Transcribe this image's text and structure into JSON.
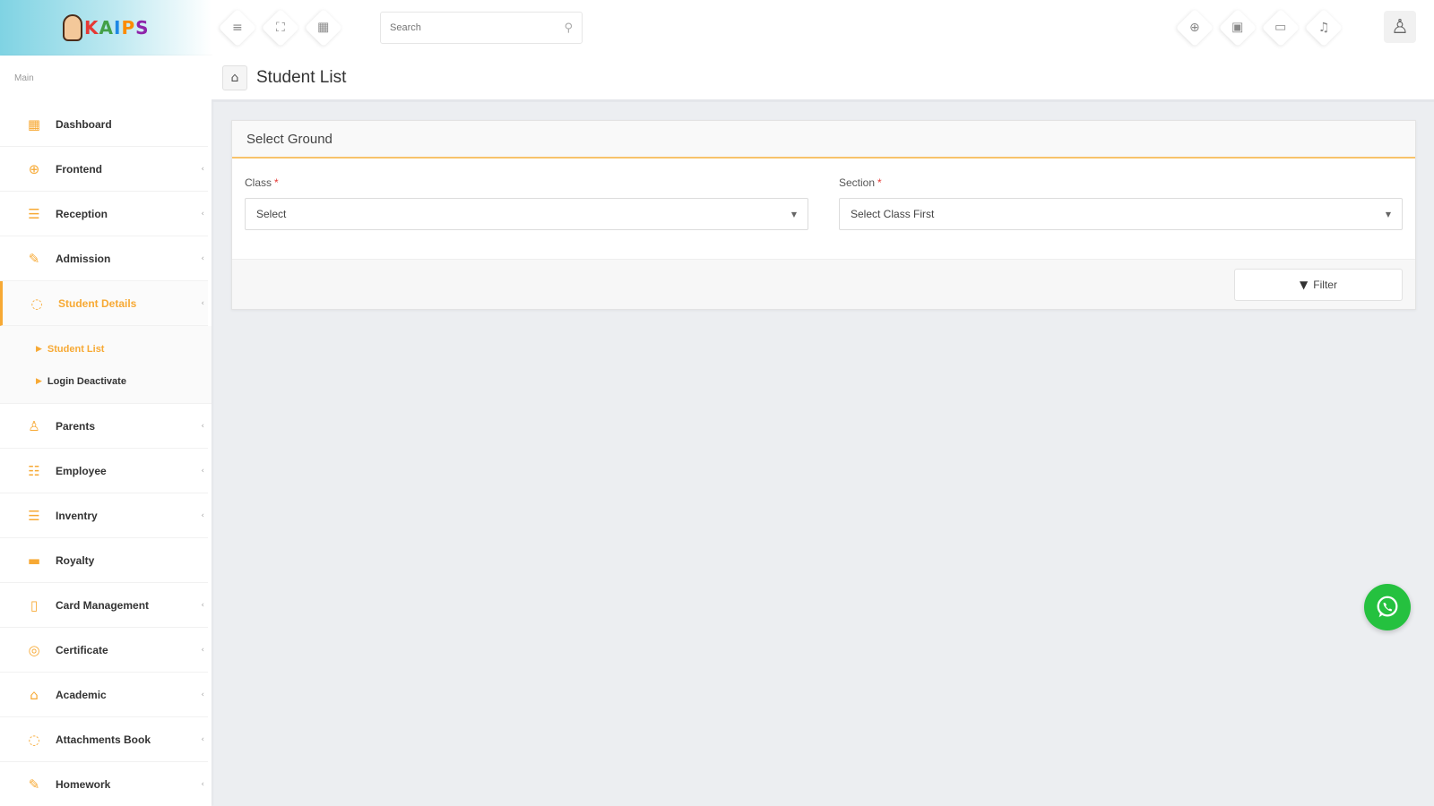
{
  "brand": {
    "logo_letters": [
      "K",
      "A",
      "I",
      "P",
      "S"
    ]
  },
  "header": {
    "search_placeholder": "Search",
    "left_tools": [
      {
        "icon": "menu-icon",
        "glyph": "≡"
      },
      {
        "icon": "fullscreen-icon",
        "glyph": "⛶"
      },
      {
        "icon": "grid-icon",
        "glyph": "▦"
      }
    ],
    "right_tools": [
      {
        "icon": "globe-icon",
        "glyph": "⊕"
      },
      {
        "icon": "calendar-icon",
        "glyph": "▣"
      },
      {
        "icon": "chat-icon",
        "glyph": "▭"
      },
      {
        "icon": "bell-icon",
        "glyph": "♫"
      }
    ]
  },
  "sidebar": {
    "heading": "Main",
    "items": [
      {
        "label": "Dashboard",
        "icon": "▦",
        "has_arrow": false
      },
      {
        "label": "Frontend",
        "icon": "⊕",
        "has_arrow": true
      },
      {
        "label": "Reception",
        "icon": "☰",
        "has_arrow": true
      },
      {
        "label": "Admission",
        "icon": "✎",
        "has_arrow": true
      },
      {
        "label": "Student Details",
        "icon": "◌",
        "has_arrow": true,
        "active": true
      },
      {
        "label": "Parents",
        "icon": "♙",
        "has_arrow": true
      },
      {
        "label": "Employee",
        "icon": "☷",
        "has_arrow": true
      },
      {
        "label": "Inventry",
        "icon": "☰",
        "has_arrow": true
      },
      {
        "label": "Royalty",
        "icon": "▬",
        "has_arrow": false
      },
      {
        "label": "Card Management",
        "icon": "▯",
        "has_arrow": true
      },
      {
        "label": "Certificate",
        "icon": "◎",
        "has_arrow": true
      },
      {
        "label": "Academic",
        "icon": "⌂",
        "has_arrow": true
      },
      {
        "label": "Attachments Book",
        "icon": "◌",
        "has_arrow": true
      },
      {
        "label": "Homework",
        "icon": "✎",
        "has_arrow": true
      }
    ],
    "submenu": [
      {
        "label": "Student List",
        "active": true
      },
      {
        "label": "Login Deactivate",
        "active": false
      }
    ]
  },
  "breadcrumb": {
    "title": "Student List"
  },
  "panel": {
    "title": "Select Ground",
    "class_label": "Class",
    "class_value": "Select",
    "section_label": "Section",
    "section_value": "Select Class First",
    "required_mark": "*",
    "filter_label": "Filter"
  },
  "colors": {
    "accent": "#f7a934",
    "whatsapp": "#25c13f"
  }
}
